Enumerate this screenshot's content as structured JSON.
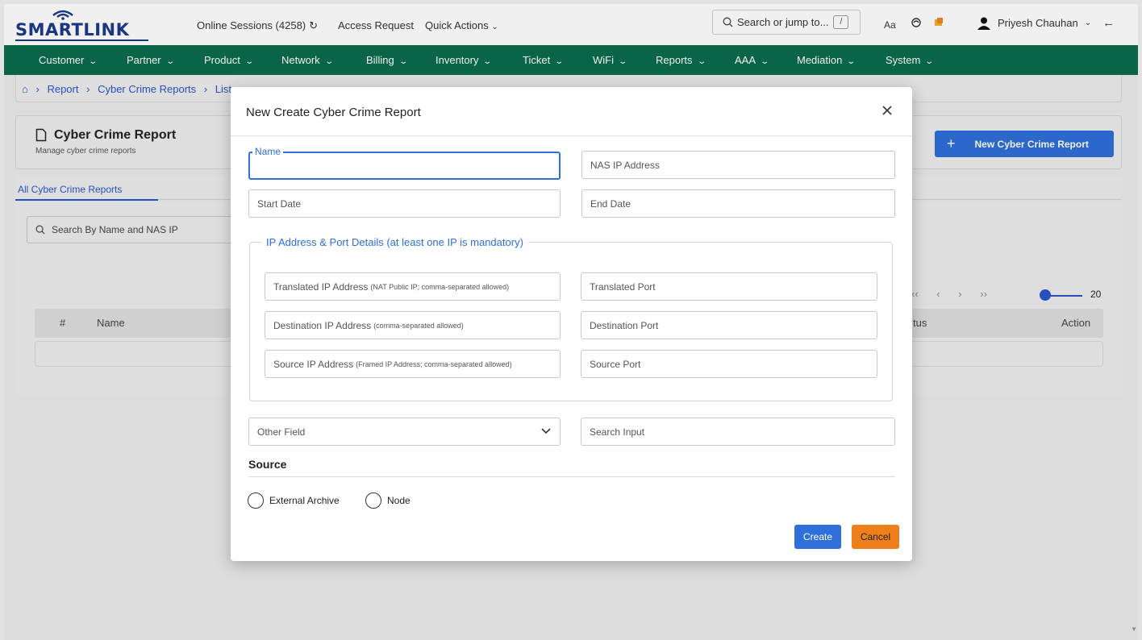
{
  "brand": {
    "logo_text": "SMARTLINK",
    "primary_color": "#1d3a8a"
  },
  "topbar": {
    "online_sessions": "Online Sessions (4258)",
    "access_request": "Access Request",
    "quick_actions": "Quick Actions",
    "search_placeholder": "Search or jump to...",
    "search_shortcut": "/",
    "font_toggle": "Aa",
    "user_name": "Priyesh Chauhan"
  },
  "nav": {
    "color": "#0b6b4c",
    "items": [
      "Customer",
      "Partner",
      "Product",
      "Network",
      "Billing",
      "Inventory",
      "Ticket",
      "WiFi",
      "Reports",
      "AAA",
      "Mediation",
      "System"
    ]
  },
  "breadcrumb": {
    "items": [
      "Report",
      "Cyber Crime Reports",
      "List"
    ]
  },
  "page": {
    "title": "Cyber Crime Report",
    "subtitle": "Manage cyber crime reports",
    "new_button": "New Cyber Crime Report",
    "tab_all": "All Cyber Crime Reports",
    "search_placeholder": "Search By Name and NAS IP",
    "page_size": "20",
    "columns": [
      "#",
      "Name",
      "tus",
      "Action"
    ]
  },
  "modal": {
    "title": "New Create Cyber Crime Report",
    "name_label": "Name",
    "name_value": "",
    "nas_ip_placeholder": "NAS IP Address",
    "start_date_placeholder": "Start Date",
    "end_date_placeholder": "End Date",
    "ip_section_legend": "IP Address & Port Details (at least one IP is mandatory)",
    "translated_ip": "Translated IP Address",
    "translated_ip_hint": "(NAT Public IP; comma-separated allowed)",
    "translated_port": "Translated Port",
    "destination_ip": "Destination IP Address",
    "destination_ip_hint": "(comma-separated allowed)",
    "destination_port": "Destination Port",
    "source_ip": "Source IP Address",
    "source_ip_hint": "(Framed IP Address; comma-separated allowed)",
    "source_port": "Source Port",
    "other_field": "Other Field",
    "search_input_placeholder": "Search Input",
    "source_title": "Source",
    "radio_external": "External Archive",
    "radio_node": "Node",
    "create_button": "Create",
    "cancel_button": "Cancel",
    "create_color": "#2f6fd9",
    "cancel_color": "#ef7f1a"
  }
}
